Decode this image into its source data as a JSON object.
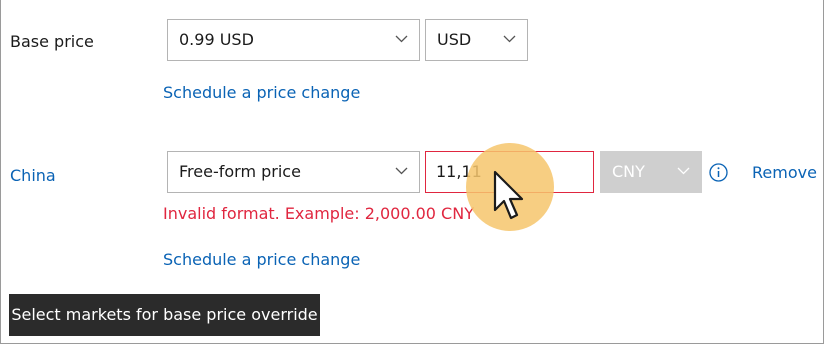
{
  "base_price": {
    "label": "Base price",
    "price_value": "0.99 USD",
    "currency_value": "USD",
    "schedule_link": "Schedule a price change"
  },
  "market": {
    "name": "China",
    "price_type_value": "Free-form price",
    "price_input_value": "11,11",
    "currency_value": "CNY",
    "remove_link": "Remove",
    "error_text": "Invalid format. Example: 2,000.00 CNY",
    "schedule_link": "Schedule a price change"
  },
  "footer": {
    "select_markets_button": "Select markets for base price override"
  },
  "colors": {
    "link": "#0a63b5",
    "error": "#e0263f",
    "cursor_highlight": "#f6c66c"
  },
  "icons": {
    "dropdown": "chevron-down-icon",
    "info": "info-icon",
    "cursor": "mouse-pointer-icon"
  }
}
